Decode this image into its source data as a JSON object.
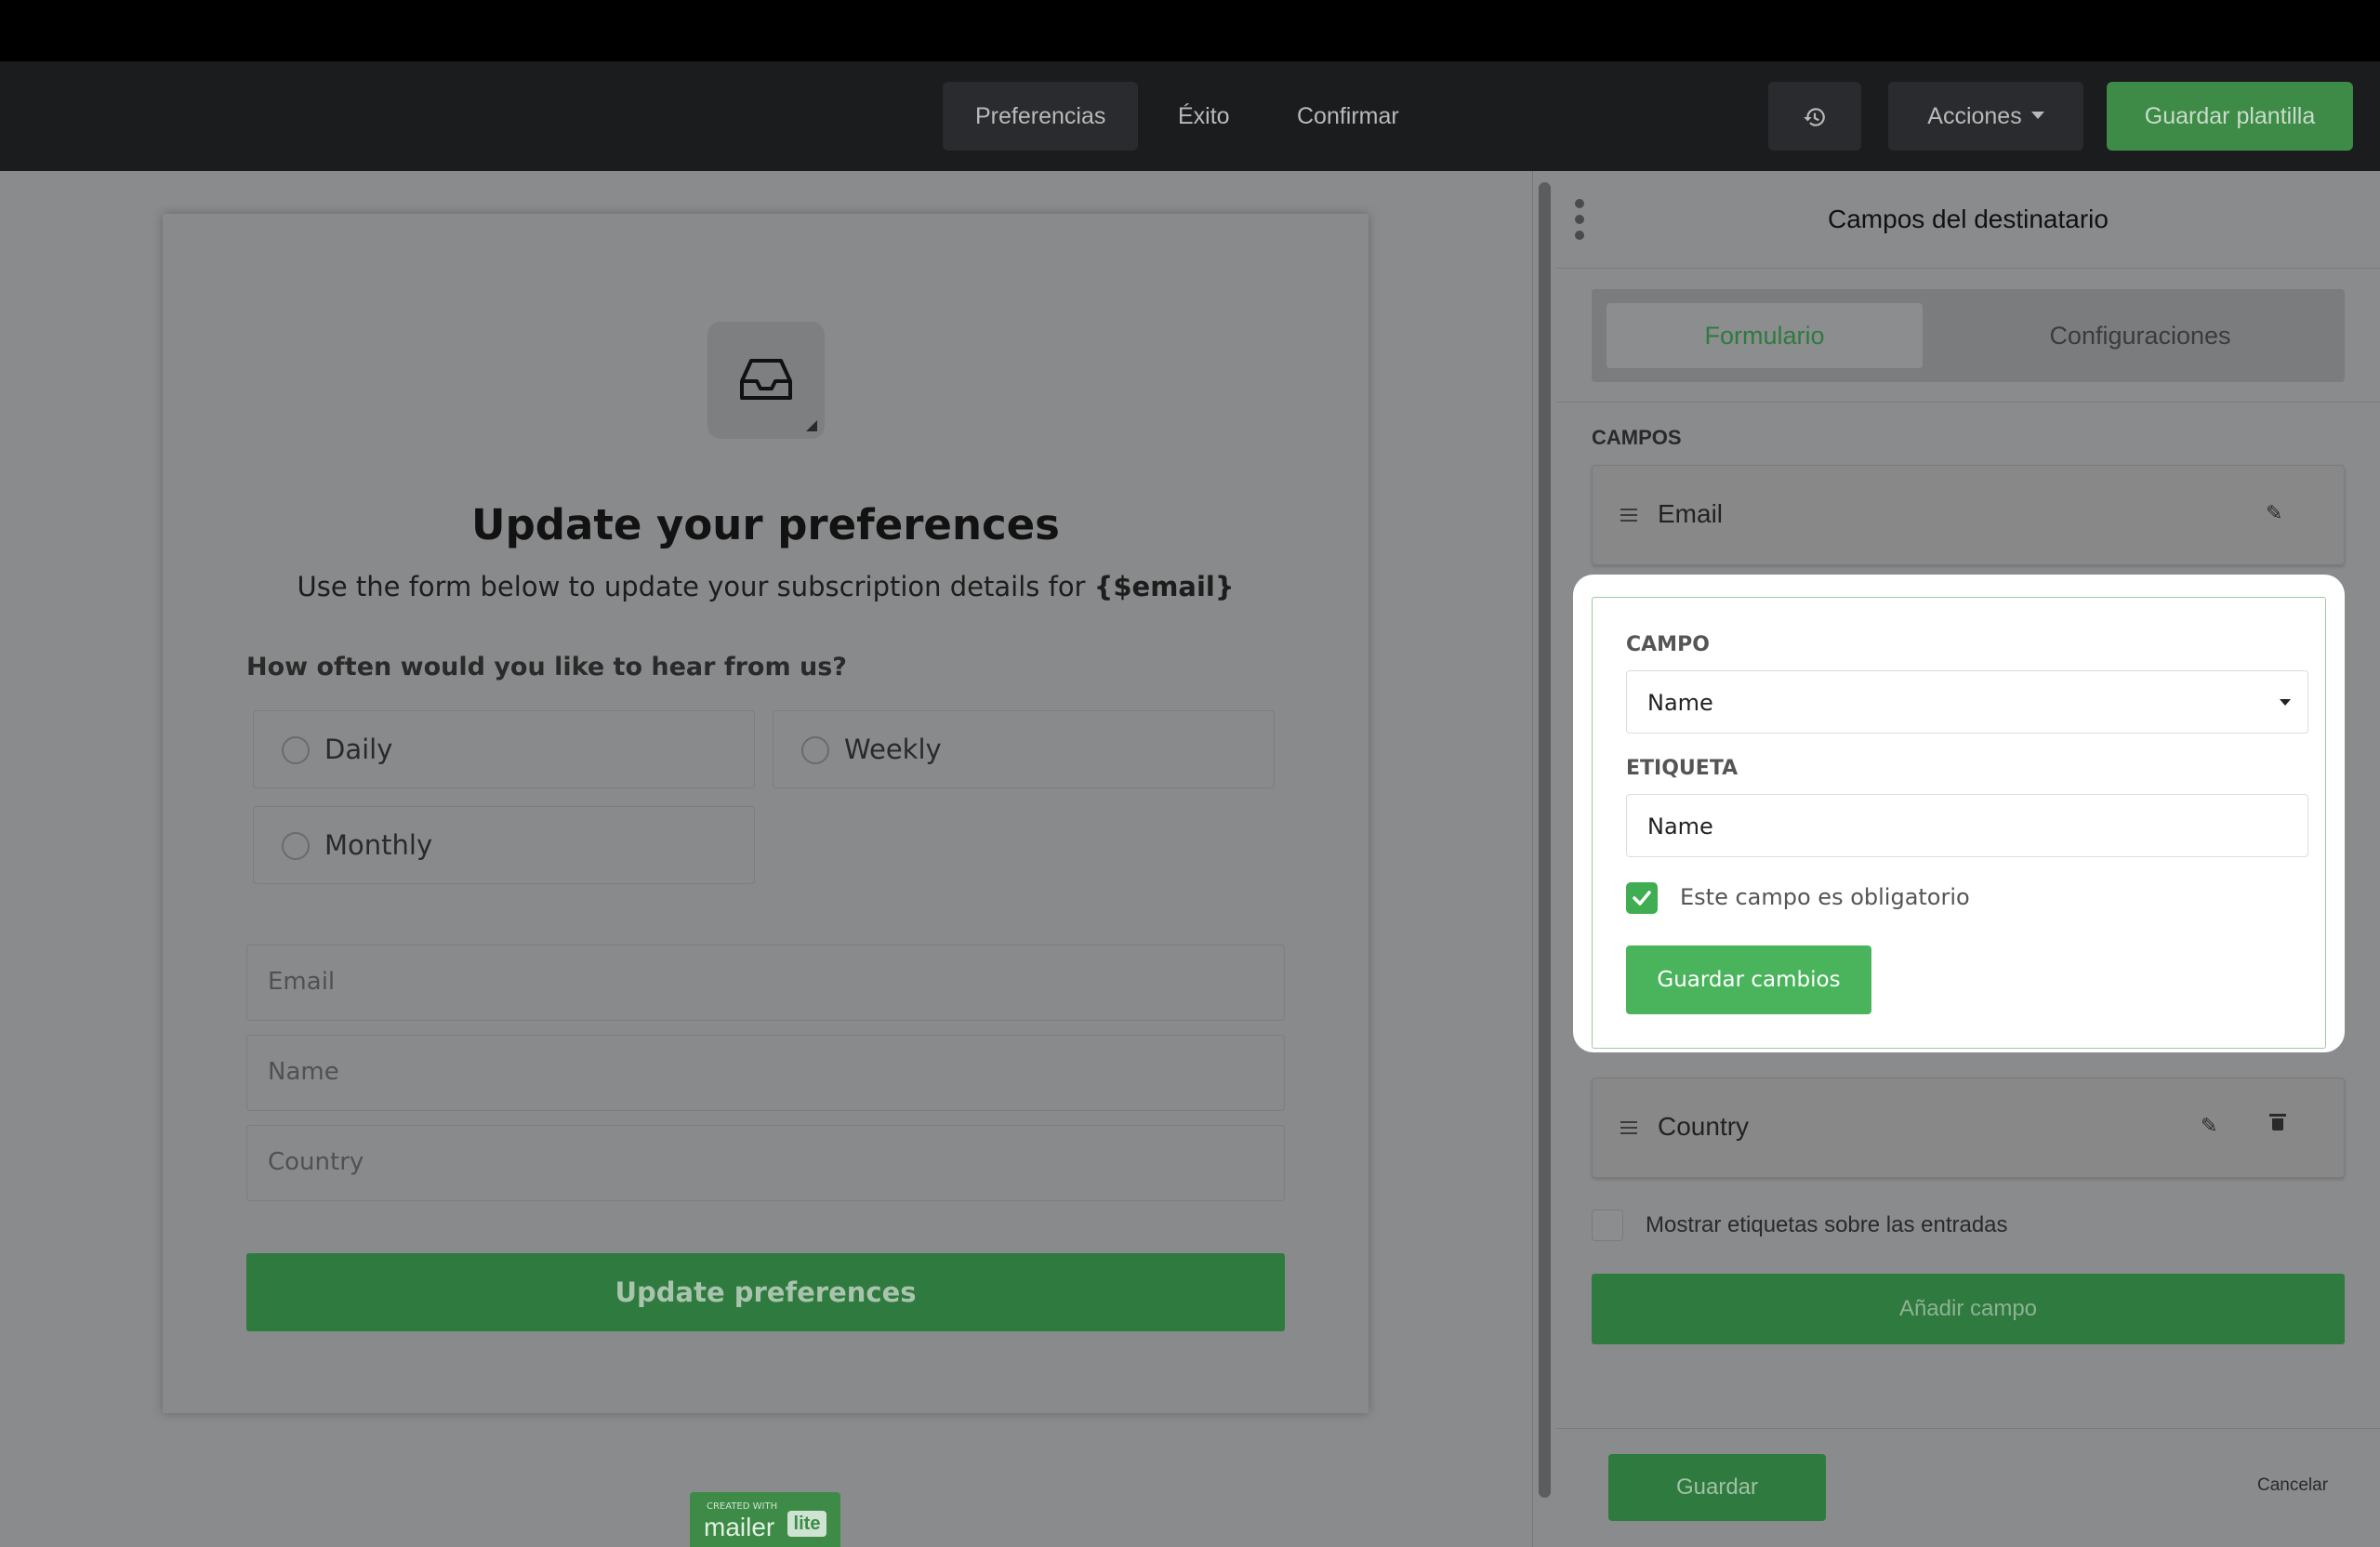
{
  "toolbar": {
    "tabs": [
      "Preferencias",
      "Éxito",
      "Confirmar"
    ],
    "actions_label": "Acciones",
    "save_template_label": "Guardar plantilla"
  },
  "preview": {
    "title": "Update your preferences",
    "subtitle_prefix": "Use the form below to update your subscription details for ",
    "subtitle_var": "{$email}",
    "question": "How often would you like to hear from us?",
    "options": [
      "Daily",
      "Weekly",
      "Monthly"
    ],
    "fields": [
      "Email",
      "Name",
      "Country"
    ],
    "button_label": "Update preferences",
    "badge_small": "CREATED WITH",
    "badge_brand": "mailer",
    "badge_lite": "lite"
  },
  "panel": {
    "title": "Campos del destinatario",
    "tab_form": "Formulario",
    "tab_settings": "Configuraciones",
    "fields_heading": "CAMPOS",
    "field_rows": [
      "Email",
      "Country"
    ],
    "editor": {
      "campo_label": "CAMPO",
      "campo_value": "Name",
      "etiqueta_label": "ETIQUETA",
      "etiqueta_value": "Name",
      "required_label": "Este campo es obligatorio",
      "required_checked": true,
      "save_label": "Guardar cambios"
    },
    "show_labels_text": "Mostrar etiquetas sobre las entradas",
    "add_field_label": "Añadir campo",
    "save_label": "Guardar",
    "cancel_label": "Cancelar"
  },
  "colors": {
    "brand_green": "#3d8b47",
    "bright_green": "#49b45c",
    "toolbar_bg": "#1b1c1e"
  }
}
